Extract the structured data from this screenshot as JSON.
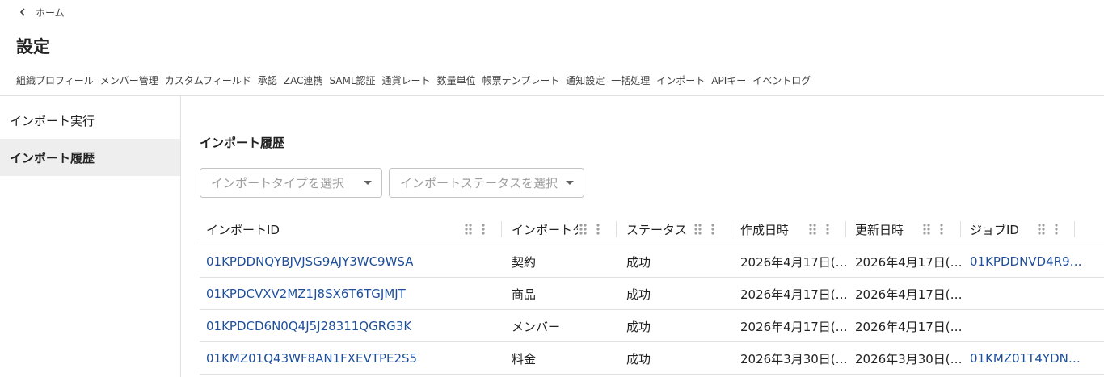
{
  "breadcrumb": {
    "label": "ホーム"
  },
  "page": {
    "title": "設定"
  },
  "tabs": [
    "組織プロフィール",
    "メンバー管理",
    "カスタムフィールド",
    "承認",
    "ZAC連携",
    "SAML認証",
    "通貨レート",
    "数量単位",
    "帳票テンプレート",
    "通知設定",
    "一括処理",
    "インポート",
    "APIキー",
    "イベントログ"
  ],
  "sidebar": {
    "items": [
      {
        "label": "インポート実行"
      },
      {
        "label": "インポート履歴"
      }
    ]
  },
  "section": {
    "title": "インポート履歴"
  },
  "filters": {
    "type_placeholder": "インポートタイプを選択",
    "status_placeholder": "インポートステータスを選択"
  },
  "table": {
    "columns": [
      "インポートID",
      "インポートタイプ",
      "ステータス",
      "作成日時",
      "更新日時",
      "ジョブID"
    ],
    "rows": [
      {
        "id": "01KPDDNQYBJVJSG9AJY3WC9WSA",
        "type": "契約",
        "status": "成功",
        "created": "2026年4月17日(…",
        "updated": "2026年4月17日(…",
        "job": "01KPDDNVD4R9…"
      },
      {
        "id": "01KPDCVXV2MZ1J8SX6T6TGJMJT",
        "type": "商品",
        "status": "成功",
        "created": "2026年4月17日(…",
        "updated": "2026年4月17日(…",
        "job": ""
      },
      {
        "id": "01KPDCD6N0Q4J5J28311QGRG3K",
        "type": "メンバー",
        "status": "成功",
        "created": "2026年4月17日(…",
        "updated": "2026年4月17日(…",
        "job": ""
      },
      {
        "id": "01KMZ01Q43WF8AN1FXEVTPE2S5",
        "type": "料金",
        "status": "成功",
        "created": "2026年3月30日(…",
        "updated": "2026年3月30日(…",
        "job": "01KMZ01T4YDN…"
      }
    ]
  },
  "colors": {
    "link": "#1e4f9c",
    "border": "#e0e0e0",
    "active_bg": "#eeeeee"
  },
  "icons": {
    "back": "chevron-left-icon",
    "dropdown": "caret-down-icon",
    "column_menu": "drag-handle-and-kebab-icon"
  }
}
